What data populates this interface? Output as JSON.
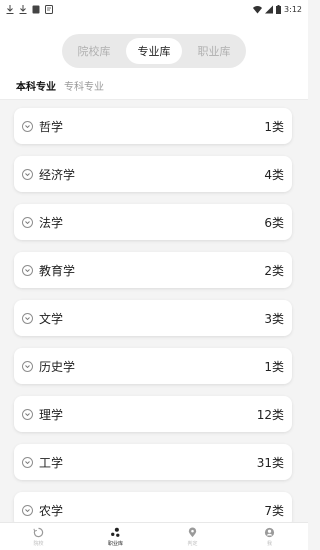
{
  "status_bar": {
    "time": "3:12"
  },
  "segments": [
    {
      "label": "院校库",
      "active": false
    },
    {
      "label": "专业库",
      "active": true
    },
    {
      "label": "职业库",
      "active": false
    }
  ],
  "subtabs": [
    {
      "label": "本科专业",
      "active": true
    },
    {
      "label": "专科专业",
      "active": false
    }
  ],
  "majors": [
    {
      "name": "哲学",
      "count": "1类"
    },
    {
      "name": "经济学",
      "count": "4类"
    },
    {
      "name": "法学",
      "count": "6类"
    },
    {
      "name": "教育学",
      "count": "2类"
    },
    {
      "name": "文学",
      "count": "3类"
    },
    {
      "name": "历史学",
      "count": "1类"
    },
    {
      "name": "理学",
      "count": "12类"
    },
    {
      "name": "工学",
      "count": "31类"
    },
    {
      "name": "农学",
      "count": "7类"
    }
  ],
  "bottom_nav": [
    {
      "label": "院校",
      "icon": "circle-refresh-icon",
      "active": false
    },
    {
      "label": "职业库",
      "icon": "nodes-icon",
      "active": true
    },
    {
      "label": "判定",
      "icon": "location-pin-icon",
      "active": false
    },
    {
      "label": "我",
      "icon": "user-icon",
      "active": false
    }
  ],
  "colors": {
    "accent": "#222222",
    "muted": "#b0b0b0",
    "background": "#f4f4f4"
  }
}
